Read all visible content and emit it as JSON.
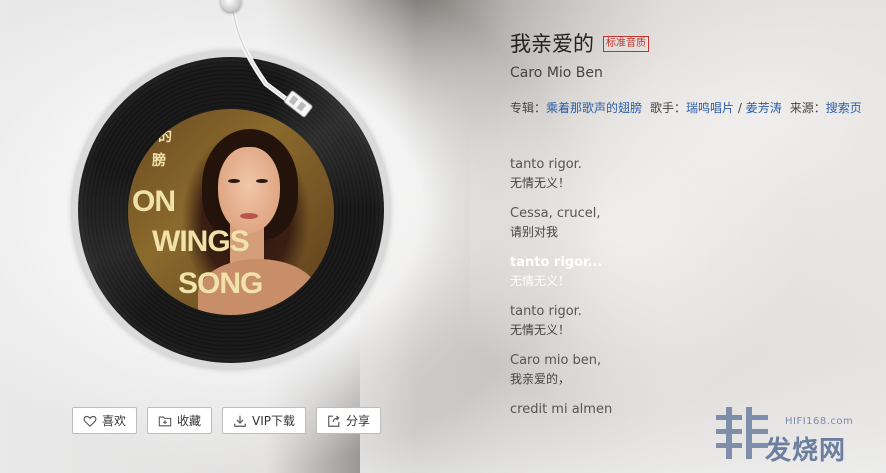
{
  "song": {
    "title": "我亲爱的",
    "quality_badge": "标准音质",
    "subtitle": "Caro Mio Ben"
  },
  "meta": {
    "album_label": "专辑：",
    "album": "乘着那歌声的翅膀",
    "singer_label": "歌手：",
    "singer_a": "瑞鸣唱片",
    "singer_sep": " / ",
    "singer_b": "姜芳涛",
    "source_label": "来源：",
    "source": "搜索页"
  },
  "lyrics": [
    {
      "original": "tanto rigor.",
      "translation": "无情无义！",
      "active": false
    },
    {
      "original": "Cessa, crucel,",
      "translation": "请别对我",
      "active": false
    },
    {
      "original": "tanto rigor...",
      "translation": "无情无义！",
      "active": true
    },
    {
      "original": "tanto rigor.",
      "translation": "无情无义！",
      "active": false
    },
    {
      "original": "Caro mio ben,",
      "translation": "我亲爱的，",
      "active": false
    },
    {
      "original": "credit mi almen",
      "translation": "",
      "active": false
    }
  ],
  "album_cover": {
    "text_lines": [
      "的",
      "膀",
      "ON",
      "WINGS",
      "SONG"
    ]
  },
  "actions": {
    "like": {
      "label": "喜欢",
      "icon": "heart-icon"
    },
    "collect": {
      "label": "收藏",
      "icon": "folder-plus-icon"
    },
    "download": {
      "label": "VIP下载",
      "icon": "download-icon"
    },
    "share": {
      "label": "分享",
      "icon": "share-icon"
    }
  },
  "watermark": {
    "url": "HIFI168.com",
    "name": "发烧网"
  },
  "colors": {
    "link": "#2b5ea8",
    "badge": "#c4322c",
    "watermark": "#6d7fa0"
  }
}
